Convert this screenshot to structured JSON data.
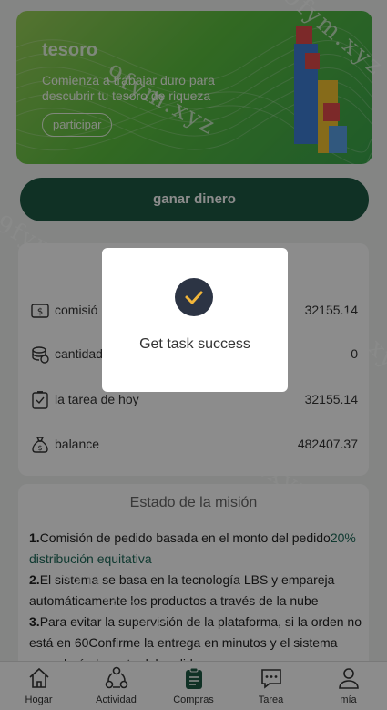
{
  "banner": {
    "title": "tesoro",
    "subtitle": "Comienza a trabajar duro para descubrir tu tesoro de riqueza",
    "button_label": "participar"
  },
  "main_button_label": "ganar dinero",
  "stats": [
    {
      "icon": "coins-icon",
      "label": "comisió",
      "value": "32155.14"
    },
    {
      "icon": "coin-stack-icon",
      "label": "cantidad",
      "value": "0"
    },
    {
      "icon": "checklist-icon",
      "label": "la tarea de hoy",
      "value": "32155.14"
    },
    {
      "icon": "money-bag-icon",
      "label": "balance",
      "value": "482407.37"
    }
  ],
  "mission": {
    "title": "Estado de la misión",
    "items": [
      {
        "num": "1.",
        "text": "Comisión de pedido basada en el monto del pedido",
        "accent": "20% distribución equitativa"
      },
      {
        "num": "2.",
        "text": "El sistema se basa en la tecnología LBS y empareja automáticamente los productos a través de la nube"
      },
      {
        "num": "3.",
        "text": "Para evitar la supervisión de la plataforma, si la orden no está en 60Confirme la entrega en minutos y el sistema congelará el monto del pedido"
      }
    ]
  },
  "tabs": [
    {
      "label": "Hogar",
      "icon": "home-icon"
    },
    {
      "label": "Actividad",
      "icon": "activity-icon"
    },
    {
      "label": "Compras",
      "icon": "clipboard-icon"
    },
    {
      "label": "Tarea",
      "icon": "chat-icon"
    },
    {
      "label": "mía",
      "icon": "user-icon"
    }
  ],
  "toast": {
    "message": "Get task success",
    "icon": "check-circle-icon"
  },
  "watermark": "9fym.xyz",
  "colors": {
    "primary": "#1e5a44",
    "accent": "#1e6a5a",
    "toast_icon_bg": "#2c3444",
    "toast_check": "#f2b63a"
  }
}
